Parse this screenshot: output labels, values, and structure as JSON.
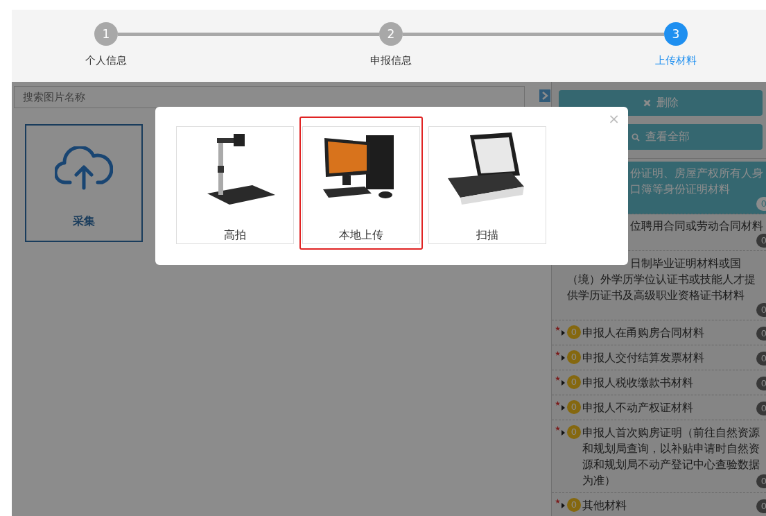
{
  "stepper": {
    "steps": [
      {
        "number": "1",
        "label": "个人信息",
        "selected": false
      },
      {
        "number": "2",
        "label": "申报信息",
        "selected": false
      },
      {
        "number": "3",
        "label": "上传材料",
        "selected": true
      }
    ]
  },
  "search": {
    "placeholder": "搜索图片名称"
  },
  "capture_tile": {
    "label": "采集"
  },
  "actions": [
    {
      "kind": "delete",
      "label": "删除"
    },
    {
      "kind": "view_all",
      "label": "查看全部"
    }
  ],
  "materials": [
    {
      "name": "份证明、房屋产权所有人身口簿等身份证明材料",
      "count": "0",
      "selected": true
    },
    {
      "name": "位聘用合同或劳动合同材料",
      "count": "0",
      "selected": false
    },
    {
      "name": "日制毕业证明材料或国（境）外学历学位认证书或技能人才提供学历证书及高级职业资格证书材料",
      "count": "0",
      "selected": false
    },
    {
      "name": "申报人在甬购房合同材料",
      "required": true,
      "expanded": false,
      "uploaded": "0",
      "count": "0",
      "selected": false
    },
    {
      "name": "申报人交付结算发票材料",
      "required": true,
      "expanded": false,
      "uploaded": "0",
      "count": "0",
      "selected": false
    },
    {
      "name": "申报人税收缴款书材料",
      "required": true,
      "expanded": false,
      "uploaded": "0",
      "count": "0",
      "selected": false
    },
    {
      "name": "申报人不动产权证材料",
      "required": true,
      "expanded": false,
      "uploaded": "0",
      "count": "0",
      "selected": false
    },
    {
      "name": "申报人首次购房证明（前往自然资源和规划局查询，以补贴申请时自然资源和规划局不动产登记中心查验数据为准）",
      "required": true,
      "expanded": false,
      "uploaded": "0",
      "count": "0",
      "selected": false
    },
    {
      "name": "其他材料",
      "required": true,
      "expanded": false,
      "uploaded": "0",
      "count": "0",
      "selected": false
    }
  ],
  "modal": {
    "close": "×",
    "options": [
      {
        "kind": "camera",
        "label": "高拍",
        "selected": false
      },
      {
        "kind": "local",
        "label": "本地上传",
        "selected": true
      },
      {
        "kind": "scanner",
        "label": "扫描",
        "selected": false
      }
    ]
  }
}
